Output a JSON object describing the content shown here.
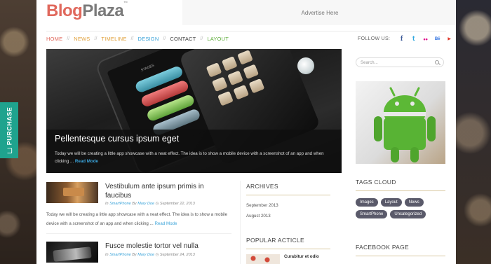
{
  "purchase": {
    "label": "PURCHASE"
  },
  "logo": {
    "part1": "Blog",
    "part2": "Plaza",
    "tm": "™"
  },
  "advert": {
    "text": "Advertise Here"
  },
  "nav": {
    "items": [
      {
        "label": "HOME",
        "color": "#e0685c"
      },
      {
        "label": "NEWS",
        "color": "#e0a13c"
      },
      {
        "label": "TIMELINE",
        "color": "#e0a13c"
      },
      {
        "label": "DESIGN",
        "color": "#3aa3d9"
      },
      {
        "label": "CONTACT",
        "color": "#444444"
      },
      {
        "label": "LAYOUT",
        "color": "#5fae3c"
      }
    ],
    "separator": "//"
  },
  "follow": {
    "label": "FOLLOW US:",
    "icons": [
      {
        "name": "facebook-icon",
        "glyph": "f",
        "color": "#3b5998"
      },
      {
        "name": "twitter-icon",
        "glyph": "t",
        "color": "#2fa8e0"
      },
      {
        "name": "flickr-icon",
        "glyph": "••",
        "color": "#e0008a"
      },
      {
        "name": "behance-icon",
        "glyph": "Bē",
        "color": "#2c6fe0"
      },
      {
        "name": "youtube-icon",
        "glyph": "▶",
        "color": "#e0392c"
      }
    ]
  },
  "featured": {
    "title": "Pellentesque cursus ipsum eget",
    "text": "Today we will be creating a little app showcase with a neat effect. The idea is to show a mobile device with a screenshot of an app and when clicking ...",
    "read_more": "Read Mode",
    "phone_label": "STAGES"
  },
  "posts": [
    {
      "title": "Vestibulum ante ipsum primis in faucibus",
      "meta_in": "In",
      "category": "SmartPhone",
      "meta_by": "By",
      "author": "Mary Doe",
      "date": "September 22, 2013",
      "excerpt": "Today we will be creating a little app showcase with a neat effect. The idea is to show a mobile device with a screenshot of an app and when clicking ...",
      "read_more": "Read Mode"
    },
    {
      "title": "Fusce molestie tortor vel nulla",
      "meta_in": "In",
      "category": "SmartPhone",
      "meta_by": "By",
      "author": "Mary Doe",
      "date": "September 24, 2013"
    }
  ],
  "archives": {
    "title": "ARCHIVES",
    "items": [
      "September 2013",
      "August 2013"
    ]
  },
  "popular": {
    "title": "POPULAR ACTICLE",
    "first_item": "Curabitur et odio"
  },
  "search": {
    "placeholder": "Search..."
  },
  "tags_cloud": {
    "title": "TAGS CLOUD",
    "tags": [
      "Images",
      "Layout",
      "News",
      "SmartPhone",
      "Uncategorized"
    ]
  },
  "facebook": {
    "title": "FACEBOOK PAGE"
  }
}
